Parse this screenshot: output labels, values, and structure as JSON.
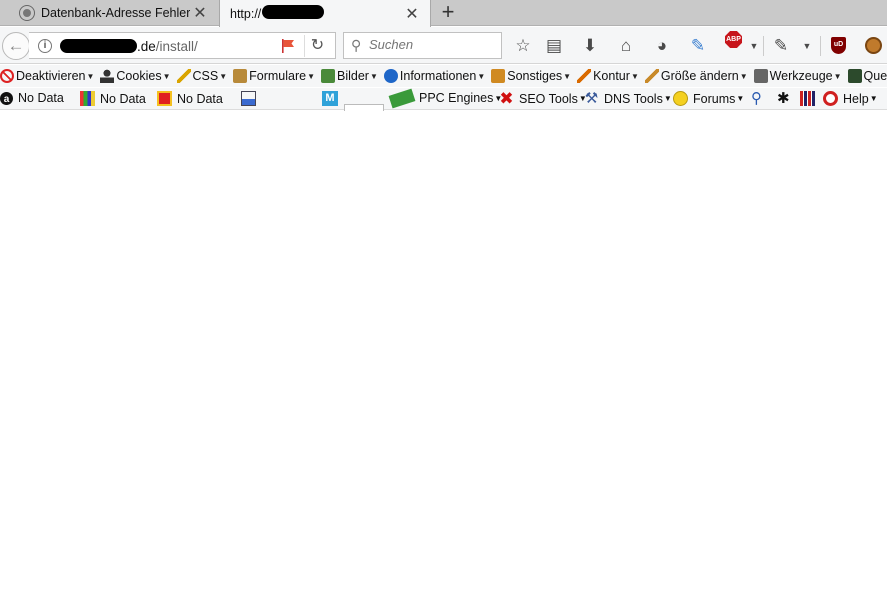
{
  "tabs": [
    {
      "title": "Datenbank-Adresse Fehler...",
      "active": false
    },
    {
      "title": "http://                          .de/install/",
      "active": true
    }
  ],
  "tab_close_glyph": "✕",
  "newtab_glyph": "+",
  "nav": {
    "url_host_tail": ".de",
    "url_path": "/install/",
    "search_placeholder": "Suchen",
    "abp_label": "ABP",
    "ublock_label": "uD"
  },
  "webdev_toolbar": [
    {
      "label": "Deaktivieren",
      "icon": "no-entry-icon",
      "color": "#d22"
    },
    {
      "label": "Cookies",
      "icon": "person-icon",
      "color": "#333"
    },
    {
      "label": "CSS",
      "icon": "pencil-icon",
      "color": "#d9a400"
    },
    {
      "label": "Formulare",
      "icon": "clipboard-icon",
      "color": "#b88a3a"
    },
    {
      "label": "Bilder",
      "icon": "image-icon",
      "color": "#4a8a3a"
    },
    {
      "label": "Informationen",
      "icon": "info-icon",
      "color": "#1e66c8"
    },
    {
      "label": "Sonstiges",
      "icon": "box-icon",
      "color": "#d08a22"
    },
    {
      "label": "Kontur",
      "icon": "pencil-icon",
      "color": "#d96a00"
    },
    {
      "label": "Größe ändern",
      "icon": "ruler-icon",
      "color": "#c88a2a"
    },
    {
      "label": "Werkzeuge",
      "icon": "tools-icon",
      "color": "#666"
    },
    {
      "label": "Quelltext an",
      "icon": "terminal-icon",
      "color": "#2c4a2c"
    }
  ],
  "seo_toolbar": {
    "amazon_label": "No Data",
    "alexa_label": "No Data",
    "ranking_label": "No Data",
    "ppc_label": "PPC Engines",
    "seo_tools_label": "SEO Tools",
    "dns_tools_label": "DNS Tools",
    "forums_label": "Forums",
    "help_label": "Help",
    "m_label": "M"
  },
  "colors": {
    "tab_strip": "#c9c9c9",
    "toolbar": "#f5f6f7",
    "abp_red": "#c7151b",
    "ublock": "#800000"
  }
}
